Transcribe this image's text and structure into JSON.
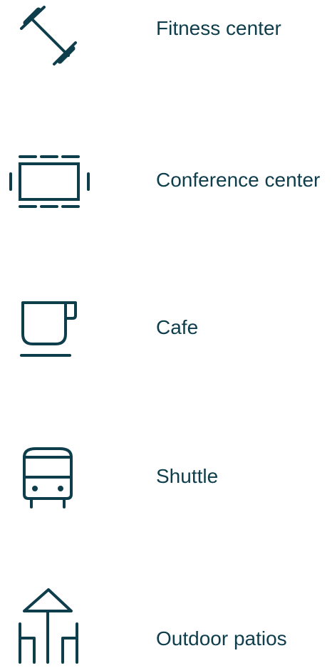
{
  "accent_color": "#0e3d4c",
  "amenities": [
    {
      "label": "Fitness center",
      "icon": "barbell-icon"
    },
    {
      "label": "Conference center",
      "icon": "conference-table-icon"
    },
    {
      "label": "Cafe",
      "icon": "coffee-cup-icon"
    },
    {
      "label": "Shuttle",
      "icon": "bus-icon"
    },
    {
      "label": "Outdoor patios",
      "icon": "patio-umbrella-icon"
    }
  ]
}
